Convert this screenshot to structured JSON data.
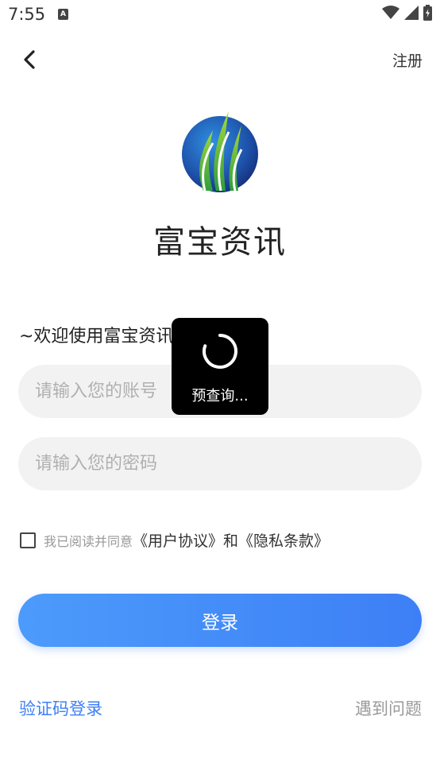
{
  "status_bar": {
    "time": "7:55",
    "notif_glyph": "A"
  },
  "nav": {
    "register_label": "注册"
  },
  "brand": {
    "name": "富宝资讯"
  },
  "welcome_text": "~欢迎使用富宝资讯",
  "form": {
    "account_placeholder": "请输入您的账号",
    "password_placeholder": "请输入您的密码",
    "agree_prefix": "我已阅读并同意",
    "user_agreement": "《用户协议》",
    "and": "和",
    "privacy_policy": "《隐私条款》",
    "login_label": "登录"
  },
  "footer": {
    "code_login": "验证码登录",
    "problem": "遇到问题"
  },
  "loading": {
    "text": "预查询..."
  },
  "colors": {
    "accent": "#3d7ff6",
    "input_bg": "#f2f2f2",
    "hint": "#999999"
  }
}
